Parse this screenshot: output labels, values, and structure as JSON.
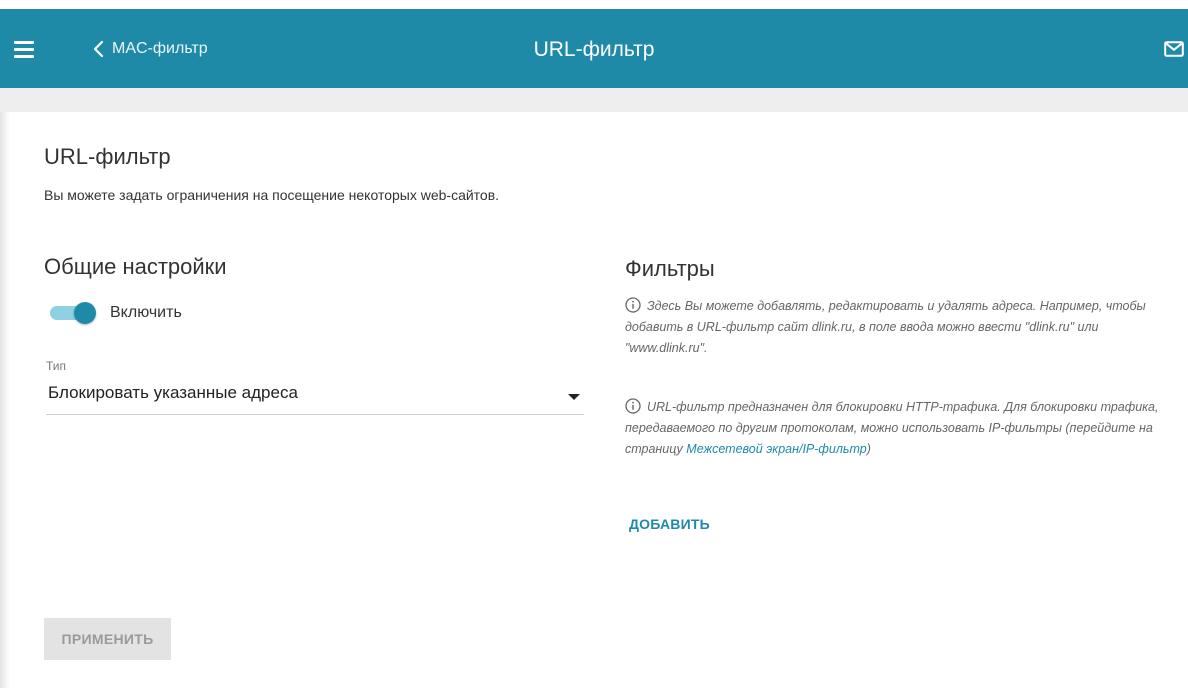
{
  "header": {
    "back_label": "MAC-фильтр",
    "title": "URL-фильтр",
    "color": "#1f8aa8"
  },
  "page": {
    "title": "URL-фильтр",
    "description": "Вы можете задать ограничения на посещение некоторых web-сайтов."
  },
  "general": {
    "title": "Общие настройки",
    "enable_label": "Включить",
    "enabled": true,
    "type_label": "Тип",
    "type_value": "Блокировать указанные адреса"
  },
  "filters": {
    "title": "Фильтры",
    "info1": "Здесь Вы можете добавлять, редактировать и удалять адреса. Например, чтобы добавить в URL-фильтр сайт dlink.ru, в поле ввода можно ввести \"dlink.ru\" или \"www.dlink.ru\".",
    "info2_prefix": "URL-фильтр предназначен для блокировки HTTP-трафика. Для блокировки трафика, передаваемого по другим протоколам, можно использовать IP-фильтры (перейдите на страницу ",
    "info2_link": "Межсетевой экран/IP-фильтр",
    "info2_suffix": ")",
    "add_label": "ДОБАВИТЬ"
  },
  "apply_label": "ПРИМЕНИТЬ",
  "icons": {
    "menu": "menu-icon",
    "back": "chevron-left-icon",
    "mail": "mail-icon",
    "info": "info-icon"
  }
}
